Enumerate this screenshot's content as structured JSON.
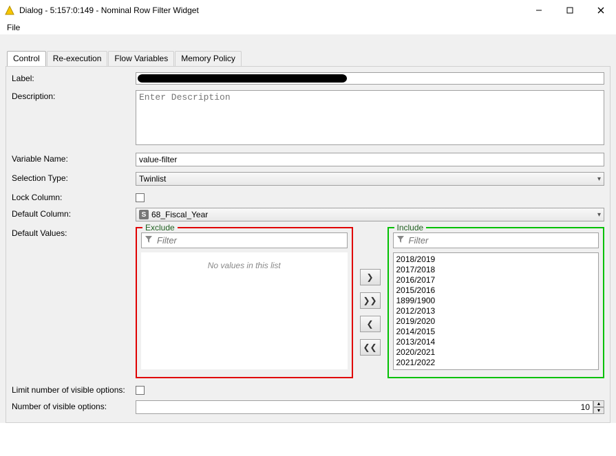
{
  "window": {
    "title": "Dialog - 5:157:0:149 - Nominal Row Filter Widget"
  },
  "menubar": {
    "file": "File"
  },
  "tabs": {
    "control": "Control",
    "reexec": "Re-execution",
    "flowvars": "Flow Variables",
    "mempolicy": "Memory Policy"
  },
  "labels": {
    "label": "Label:",
    "description": "Description:",
    "variable_name": "Variable Name:",
    "selection_type": "Selection Type:",
    "lock_column": "Lock Column:",
    "default_column": "Default Column:",
    "default_values": "Default Values:",
    "limit_visible": "Limit number of visible options:",
    "num_visible": "Number of visible options:"
  },
  "fields": {
    "description_placeholder": "Enter Description",
    "variable_name": "value-filter",
    "selection_type": "Twinlist",
    "default_column": "68_Fiscal_Year",
    "num_visible": "10"
  },
  "twinlist": {
    "exclude_legend": "Exclude",
    "include_legend": "Include",
    "filter_placeholder": "Filter",
    "empty_text": "No values in this list",
    "include_items": [
      "2018/2019",
      "2017/2018",
      "2016/2017",
      "2015/2016",
      "1899/1900",
      "2012/2013",
      "2019/2020",
      "2014/2015",
      "2013/2014",
      "2020/2021",
      "2021/2022"
    ]
  }
}
